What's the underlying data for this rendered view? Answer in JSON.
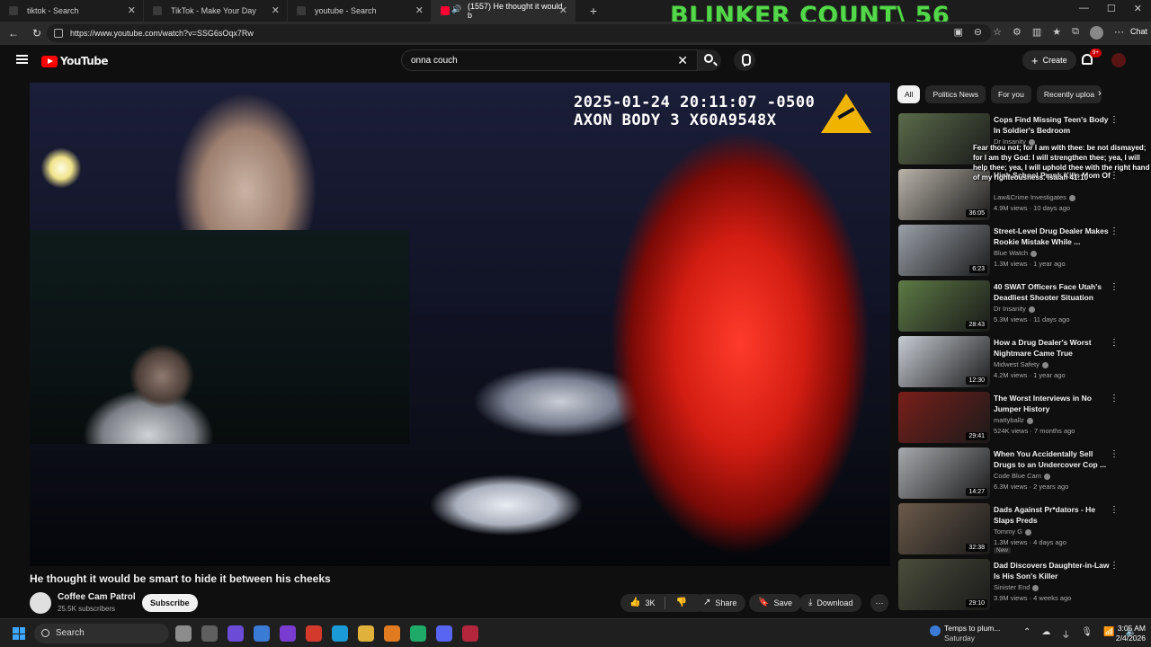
{
  "browser": {
    "tabs": [
      {
        "label": "tiktok - Search",
        "active": false
      },
      {
        "label": "TikTok - Make Your Day",
        "active": false
      },
      {
        "label": "youtube - Search",
        "active": false
      },
      {
        "label": "(1557) He thought it would b",
        "active": true
      }
    ],
    "new_tab_icon": "plus-icon",
    "url": "https://www.youtube.com/watch?v=SSG6sOqx7Rw",
    "chat_label": "Chat"
  },
  "stream_overlay": {
    "counter_text": "BLINKER COUNT\\ 56",
    "verse_text": "Fear thou not; for I am with thee: be not dismayed; for I am thy God: I will strengthen thee; yea, I will help thee; yea, I will uphold thee with the right hand of my righteousness. Isaiah 41:10",
    "counter_color": "#53d84a"
  },
  "youtube": {
    "logo_text": "YouTube",
    "search_value": "onna couch",
    "create_label": "Create",
    "notification_badge": "9+",
    "accent": "#ff0000"
  },
  "player": {
    "stamp_line1": "2025-01-24 20:11:07 -0500",
    "stamp_line2": "AXON BODY 3 X60A9548X"
  },
  "video": {
    "title": "He thought it would be smart to hide it between his cheeks",
    "channel": "Coffee Cam Patrol",
    "subscribers": "25.5K subscribers",
    "subscribe_label": "Subscribe",
    "likes": "3K",
    "share_label": "Share",
    "save_label": "Save",
    "download_label": "Download"
  },
  "sidebar": {
    "chips": [
      "All",
      "Politics News",
      "For you",
      "Recently uploa"
    ],
    "recommendations": [
      {
        "title": "Cops Find Missing Teen's Body In Soldier's Bedroom",
        "channel": "Dr Insanity",
        "meta": "",
        "duration": "",
        "thumb_color": "#5a6b4a"
      },
      {
        "title": "High School Prank Kills Mom Of",
        "channel": "Law&Crime Investigates",
        "meta": "4.9M views · 10 days ago",
        "duration": "36:05",
        "thumb_color": "#b9b3a9"
      },
      {
        "title": "Street-Level Drug Dealer Makes Rookie Mistake While ...",
        "channel": "Blue Watch",
        "meta": "1.3M views · 1 year ago",
        "duration": "6:23",
        "thumb_color": "#9aa0a8"
      },
      {
        "title": "40 SWAT Officers Face Utah's Deadliest Shooter Situation",
        "channel": "Dr Insanity",
        "meta": "5.3M views · 11 days ago",
        "duration": "28:43",
        "thumb_color": "#5d7a45"
      },
      {
        "title": "How a Drug Dealer's Worst Nightmare Came True",
        "channel": "Midwest Safety",
        "meta": "4.2M views · 1 year ago",
        "duration": "12:30",
        "thumb_color": "#c7ccd3"
      },
      {
        "title": "The Worst Interviews in No Jumper History",
        "channel": "mattyballz",
        "meta": "524K views · 7 months ago",
        "duration": "29:41",
        "thumb_color": "#7a1f1a"
      },
      {
        "title": "When You Accidentally Sell Drugs to an Undercover Cop ...",
        "channel": "Code Blue Cam",
        "meta": "6.3M views · 2 years ago",
        "duration": "14:27",
        "thumb_color": "#a6a9ad"
      },
      {
        "title": "Dads Against Pr*dators - He Slaps Preds",
        "channel": "Tommy G",
        "meta": "1.3M views · 4 days ago",
        "badge": "New",
        "duration": "32:38",
        "thumb_color": "#6b5a4a"
      },
      {
        "title": "Dad Discovers Daughter-in-Law Is His Son's Killer",
        "channel": "Sinister End",
        "meta": "3.9M views · 4 weeks ago",
        "duration": "29:10",
        "thumb_color": "#4a4d3a"
      }
    ]
  },
  "taskbar": {
    "search_label": "Search",
    "weather_title": "Temps to plum...",
    "weather_sub": "Saturday",
    "time": "3:05 AM",
    "date": "2/4/2026"
  }
}
